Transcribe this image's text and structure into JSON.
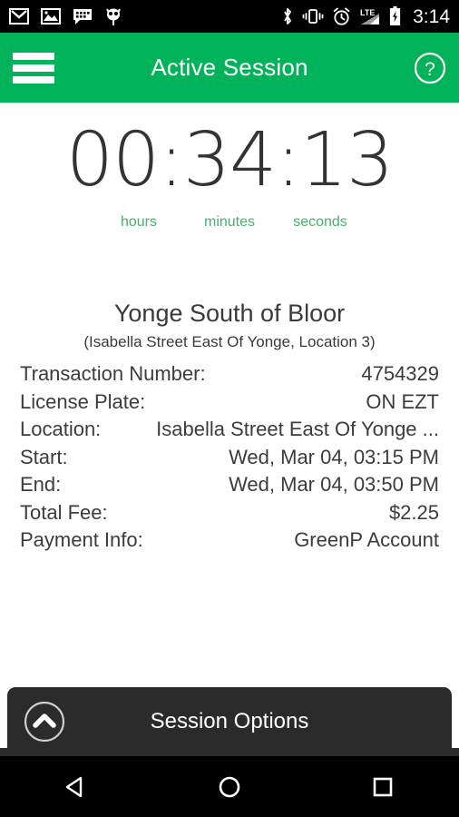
{
  "status_bar": {
    "left_icons": [
      "gmail-icon",
      "gallery-icon",
      "bbm-message-icon",
      "owl-app-icon"
    ],
    "right_icons": [
      "bluetooth-icon",
      "vibrate-icon",
      "alarm-icon",
      "lte-signal-icon",
      "battery-charging-icon"
    ],
    "signal_label": "LTE",
    "time": "3:14",
    "background": "#000000"
  },
  "app_bar": {
    "title": "Active Session",
    "menu_icon": "hamburger-menu-icon",
    "help_icon": "help-circle-icon",
    "background": "#00b259",
    "text_color": "#ffffff"
  },
  "timer": {
    "display": "00:34:13",
    "hours": "00",
    "minutes": "34",
    "seconds": "13",
    "label_hours": "hours",
    "label_minutes": "minutes",
    "label_seconds": "seconds",
    "label_color": "#4aaf6e",
    "digit_color": "#333333"
  },
  "location": {
    "name": "Yonge South of Bloor",
    "sub": "(Isabella Street East Of Yonge, Location 3)"
  },
  "details": [
    {
      "label": "Transaction Number:",
      "value": "4754329"
    },
    {
      "label": "License Plate:",
      "value": "ON EZT"
    },
    {
      "label": "Location:",
      "value": "Isabella Street East Of Yonge ..."
    },
    {
      "label": "Start:",
      "value": "Wed, Mar 04, 03:15 PM"
    },
    {
      "label": "End:",
      "value": "Wed, Mar 04, 03:50 PM"
    },
    {
      "label": "Total Fee:",
      "value": "$2.25"
    },
    {
      "label": "Payment Info:",
      "value": "GreenP Account"
    }
  ],
  "session_options": {
    "label": "Session Options",
    "expand_icon": "chevron-up-circle-icon",
    "background": "#2b2b2b"
  },
  "nav_bar": {
    "back": "back-triangle-icon",
    "home": "home-circle-icon",
    "recents": "recents-square-icon"
  }
}
